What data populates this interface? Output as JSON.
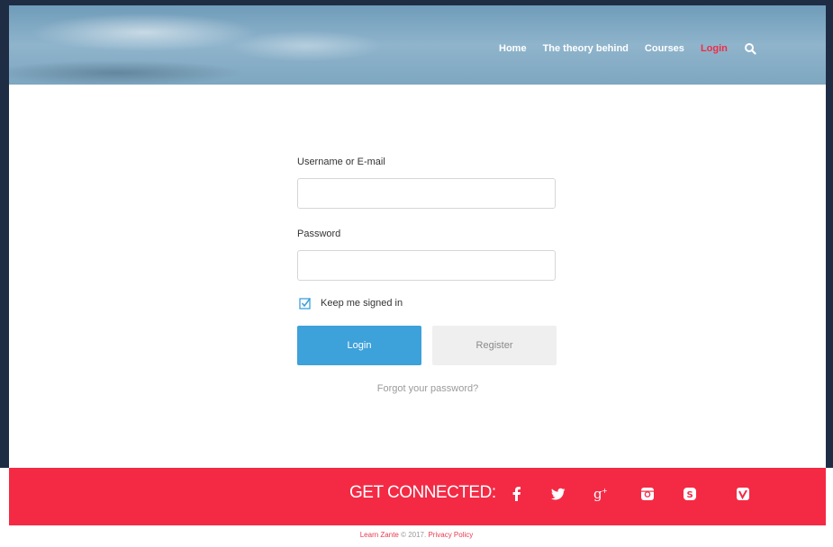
{
  "nav": {
    "items": [
      "Home",
      "The theory behind",
      "Courses",
      "Login"
    ],
    "active": "Login",
    "search_icon": "search-icon"
  },
  "form": {
    "username_label": "Username or E-mail",
    "username_value": "",
    "password_label": "Password",
    "password_value": "",
    "remember_label": "Keep me signed in",
    "remember_checked": true,
    "login_label": "Login",
    "register_label": "Register",
    "forgot_label": "Forgot your password?"
  },
  "footer": {
    "connect_title": "GET CONNECTED:",
    "social_icons": [
      "facebook-icon",
      "twitter-icon",
      "google-plus-icon",
      "instagram-icon",
      "skype-icon",
      "vimeo-icon"
    ],
    "brand": "Learn Zante",
    "copyright_text": "© 2017.",
    "privacy_label": "Privacy Policy"
  },
  "colors": {
    "accent_red": "#f42a45",
    "login_blue": "#3da1da",
    "frame": "#1f2d44"
  }
}
